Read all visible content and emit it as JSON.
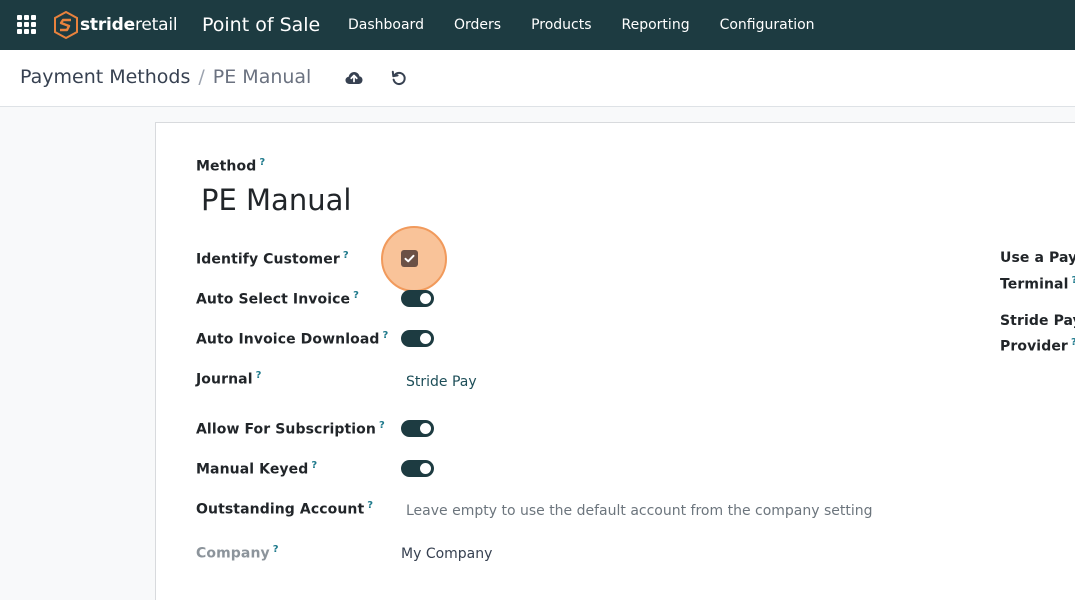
{
  "navbar": {
    "brand_prefix": "stride",
    "brand_suffix": "retail",
    "app_title": "Point of Sale",
    "menu": [
      "Dashboard",
      "Orders",
      "Products",
      "Reporting",
      "Configuration"
    ]
  },
  "breadcrumb": {
    "parent": "Payment Methods",
    "separator": "/",
    "current": "PE Manual"
  },
  "form": {
    "method_label": "Method",
    "method_value": "PE Manual",
    "help_mark": "?",
    "fields": {
      "identify_customer": {
        "label": "Identify Customer",
        "checked": true
      },
      "auto_select_invoice": {
        "label": "Auto Select Invoice",
        "on": true
      },
      "auto_invoice_download": {
        "label": "Auto Invoice Download",
        "on": true
      },
      "journal": {
        "label": "Journal",
        "value": "Stride Pay"
      },
      "allow_for_subscription": {
        "label": "Allow For Subscription",
        "on": true
      },
      "manual_keyed": {
        "label": "Manual Keyed",
        "on": true
      },
      "outstanding_account": {
        "label": "Outstanding Account",
        "placeholder": "Leave empty to use the default account from the company setting"
      },
      "company": {
        "label": "Company",
        "value": "My Company"
      }
    },
    "right_fields": {
      "payment_terminal_line1": "Use a Payr",
      "payment_terminal_line2": "Terminal",
      "provider_line1": "Stride Payr",
      "provider_line2": "Provider"
    }
  },
  "colors": {
    "navbar": "#1d3b41",
    "toggle_on": "#1d3b41",
    "checkbox": "#6b5146",
    "focus_ring": "#f19a5c"
  }
}
